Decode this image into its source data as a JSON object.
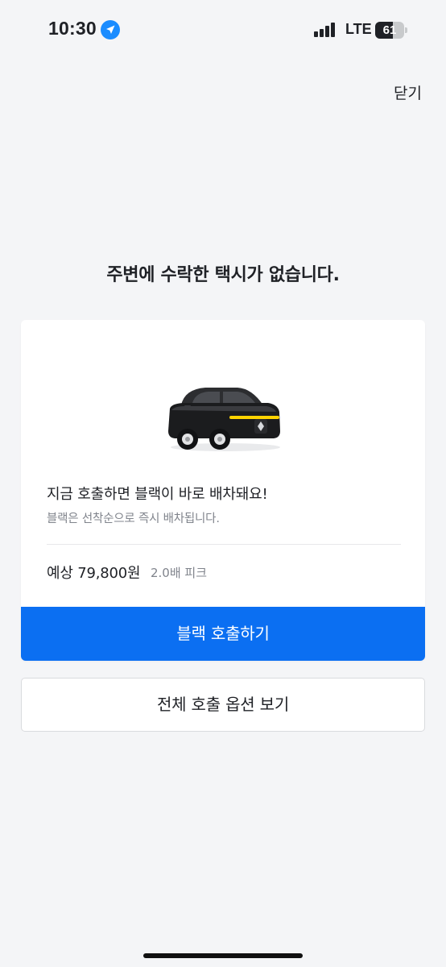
{
  "status_bar": {
    "time": "10:30",
    "network": "LTE",
    "battery_percent": "61",
    "battery_level": 0.61,
    "signal_bars": 4,
    "location_icon": "location-arrow-icon",
    "signal_icon": "cellular-signal-icon",
    "battery_icon": "battery-icon"
  },
  "header": {
    "close_label": "닫기"
  },
  "main": {
    "title": "주변에 수락한 택시가 없습니다."
  },
  "offer_card": {
    "illustration": "black-car-icon",
    "headline": "지금 호출하면 블랙이 바로 배차돼요!",
    "subtext": "블랙은 선착순으로 즉시 배차됩니다.",
    "fare_estimate": "예상 79,800원",
    "surge_label": "2.0배 피크",
    "primary_button_label": "블랙 호출하기"
  },
  "secondary_button_label": "전체 호출 옵션 보기",
  "colors": {
    "background": "#f4f5f7",
    "primary": "#0b6ff2",
    "text": "#1f2126",
    "muted_text": "#80848c",
    "car_accent": "#ffd400"
  }
}
